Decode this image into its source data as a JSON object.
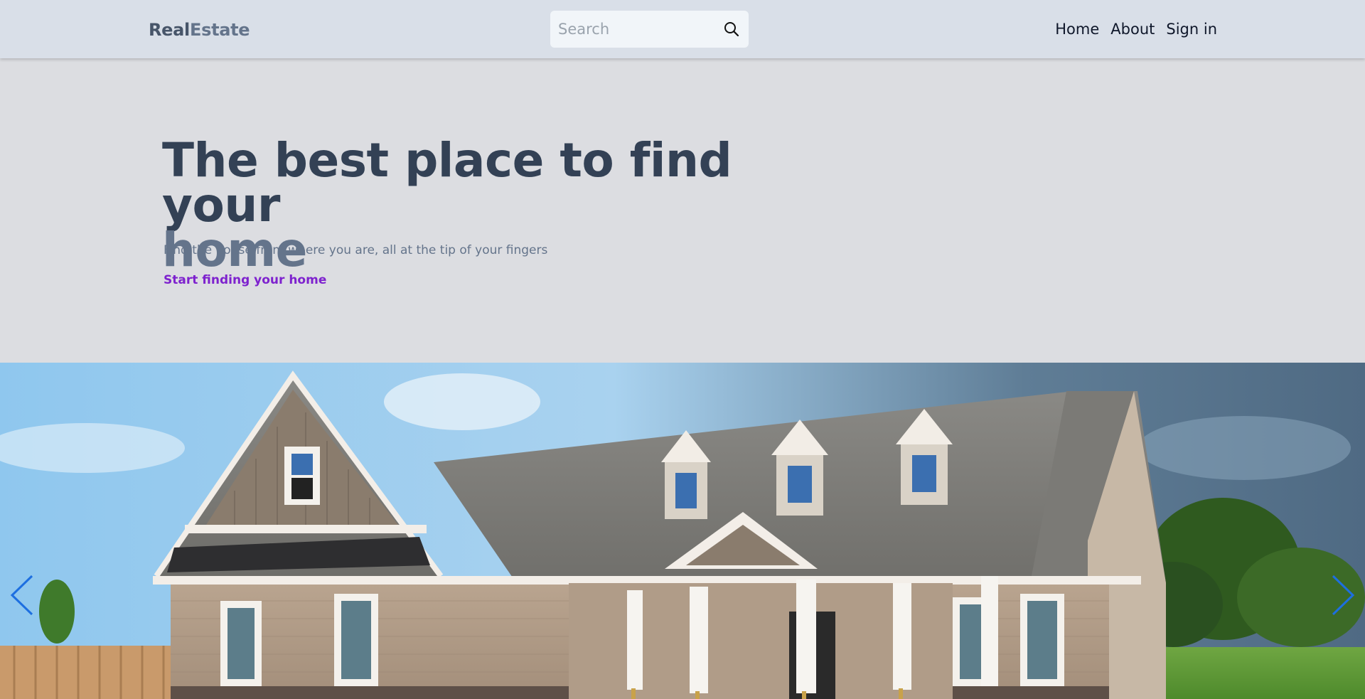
{
  "header": {
    "logo_part1": "Real",
    "logo_part2": "Estate",
    "search": {
      "placeholder": "Search"
    },
    "nav": [
      "Home",
      "About",
      "Sign in"
    ]
  },
  "hero": {
    "title": "The best place to find your",
    "title_accent": "home",
    "subtitle": "Find the house from where you are, all at the tip of your fingers",
    "cta": "Start finding your home"
  },
  "carousel": {
    "slide_image": "house-photo",
    "prev_icon": "chevron-left-icon",
    "next_icon": "chevron-right-icon"
  },
  "colors": {
    "header_bg": "#d9dfe8",
    "hero_bg": "#dcdde1",
    "title": "#334155",
    "title_accent": "#64748b",
    "cta": "#7e22ce",
    "arrow": "#1d6fe0"
  }
}
